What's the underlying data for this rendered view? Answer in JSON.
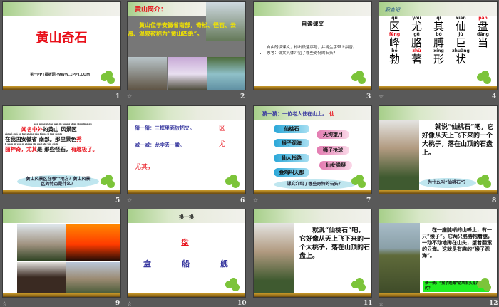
{
  "slides": [
    {
      "number": "1",
      "title": "黄山奇石",
      "footer": "第一PPT模板网-WWW.1PPT.COM"
    },
    {
      "number": "2",
      "heading": "黄山简介：",
      "body": "黄山位于安徽省南部，奇松、怪石、云海、温泉被称为“黄山四绝”。"
    },
    {
      "number": "3",
      "title": "自读课文",
      "bullets": [
        "自由朗读课文，标出段落序号，并将生字带上拼音。",
        "思考：课文具体介绍了哪些奇特的石头?"
      ]
    },
    {
      "number": "4",
      "heading": "我会记",
      "chars": [
        {
          "py": "qū",
          "c": "区"
        },
        {
          "py": "yóu",
          "c": "尤"
        },
        {
          "py": "qí",
          "c": "其"
        },
        {
          "py": "xiān",
          "c": "仙"
        },
        {
          "py": "pán",
          "c": "盘"
        },
        {
          "py": "fēng",
          "c": "峰"
        },
        {
          "py": "gē",
          "c": "胳"
        },
        {
          "py": "bó",
          "c": "膊"
        },
        {
          "py": "jù",
          "c": "巨"
        },
        {
          "py": "dāng",
          "c": "当"
        },
        {
          "py": "bó",
          "c": "勃"
        },
        {
          "py": "zhù",
          "c": "著"
        },
        {
          "py": "xíng",
          "c": "形"
        },
        {
          "py": "zhuàng",
          "c": "状"
        }
      ]
    },
    {
      "number": "5",
      "pinyin1": "wén míng zhōng wài de huáng shān fēng jǐng qū",
      "line1a": "闻名中外",
      "line1b": "的黄山 风景区",
      "pinyin2": "zài wǒ guó ān huī shěng nán bù  nà lǐ jǐng sè xiù",
      "line2a": "在我国安徽省 南部。那里景色",
      "line2b": "秀",
      "pinyin3": "lì shén qí  yóu qí shì nà xiē guài shí  yǒu qù jí",
      "line3a": "丽神奇，尤其",
      "line3b": "是 那些怪石，",
      "line3c": "有趣极了。",
      "question": "黄山风景区在哪个地方？黄山风景区的特点是什么？"
    },
    {
      "number": "6",
      "riddle1": "猜一猜：三框里面放把叉。",
      "answer1": "区",
      "riddle2": "减一减：龙字丢一撇。",
      "answer2": "尤",
      "word": "尤其，"
    },
    {
      "number": "7",
      "riddle": "猜一猜：一位老人住在山上。",
      "answer": "仙",
      "left": [
        "仙桃石",
        "猴子观海",
        "仙人指路",
        "金鸡叫天都"
      ],
      "right": [
        "天狗望月",
        "狮子抢球",
        "仙女弹琴"
      ],
      "question": "课文介绍了哪些奇特的石头？"
    },
    {
      "number": "8",
      "body": "就说“仙桃石”吧，它好像从天上飞下来的一个大桃子，落在山顶的石盘上。",
      "question": "为什么叫“仙桃石”？"
    },
    {
      "number": "9"
    },
    {
      "number": "10",
      "title": "换一换",
      "top": "盘",
      "options": [
        "盒",
        "船",
        "舰"
      ]
    },
    {
      "number": "11",
      "body": "就说“仙桃石”吧，它好像从天上飞下来的一个大桃子，落在山顶的石盘上。"
    },
    {
      "number": "12",
      "body": "在一座陡峭的山峰上，有一只“猴子”。它两只胳膊抱着腿，一动不动地蹲在山头，望着翻滚的云海。这就是有趣的“猴子观海”。",
      "question": "读一读：“猴子观海”这块石头是怎样的？"
    }
  ],
  "colors": {
    "background": "#595959",
    "red": "#e8101a",
    "blue": "#3a3aa0",
    "yellow": "#f2e400",
    "green_box": "#22ee22"
  }
}
